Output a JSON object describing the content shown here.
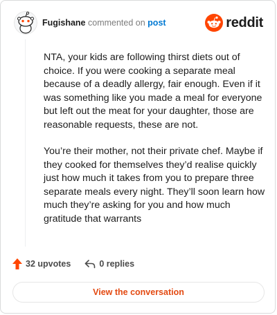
{
  "header": {
    "username": "Fugishane",
    "commented_text": "commented on",
    "post_link": "post",
    "brand": "reddit"
  },
  "comment": {
    "paragraphs": [
      "NTA, your kids are following thirst diets out of choice. If you were cooking a separate meal because of a deadly allergy, fair enough. Even if it was something like you made a meal for everyone but left out the meat for your daughter, those are reasonable requests, these are not.",
      "You’re their mother, not their private chef. Maybe if they cooked for themselves they’d realise quickly just how much it takes from you to prepare three separate meals every night. They’ll soon learn how much they’re asking for you and how much gratitude that warrants"
    ]
  },
  "actions": {
    "upvotes": "32 upvotes",
    "replies": "0 replies"
  },
  "cta": {
    "label": "View the conversation"
  },
  "colors": {
    "reddit_orange": "#ff4500",
    "link_blue": "#0079d3",
    "cta_text": "#e34a12"
  },
  "icons": [
    "snoo-avatar-icon",
    "reddit-logo-icon",
    "upvote-icon",
    "reply-icon"
  ]
}
